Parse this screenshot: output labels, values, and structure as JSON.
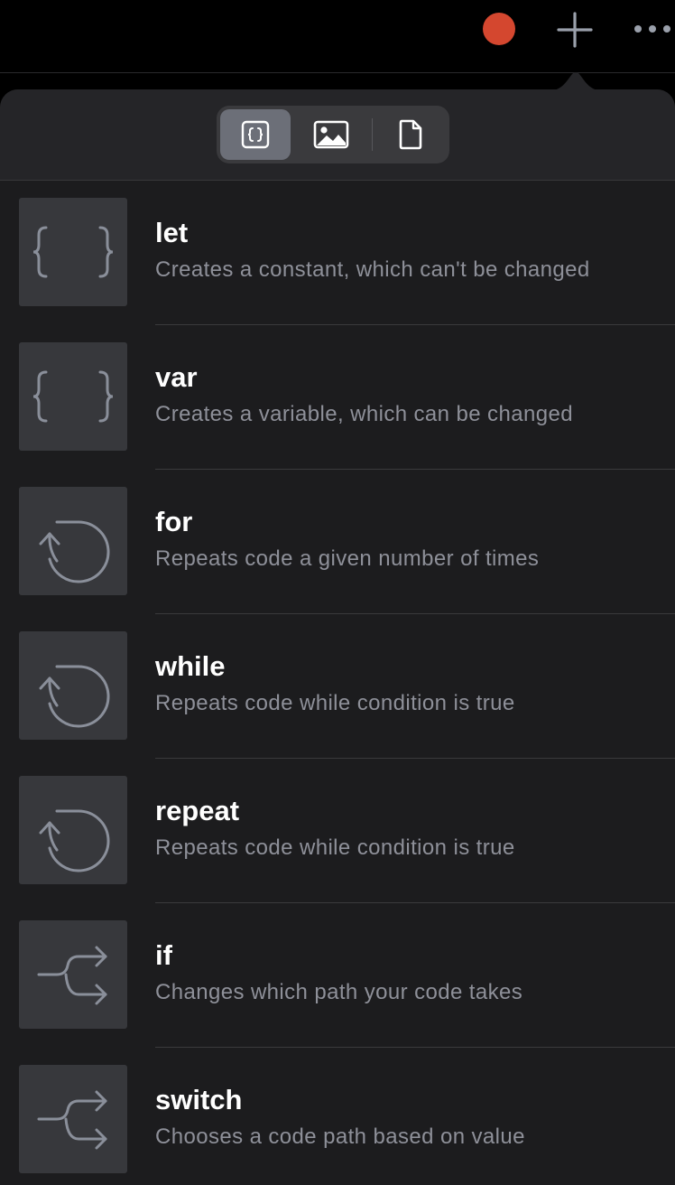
{
  "colors": {
    "record": "#d4472f",
    "accent": "#8e9099",
    "icon_stroke": "#8a8f9a"
  },
  "toolbar": {
    "record_icon": "record-dot-icon",
    "add_icon": "plus-icon",
    "more_icon": "ellipsis-icon"
  },
  "tabs": [
    {
      "icon": "code-braces-icon",
      "selected": true
    },
    {
      "icon": "image-icon",
      "selected": false
    },
    {
      "icon": "file-icon",
      "selected": false
    }
  ],
  "items": [
    {
      "name": "let",
      "description": "Creates a constant, which can't be changed",
      "icon": "braces-icon"
    },
    {
      "name": "var",
      "description": "Creates a variable, which can be changed",
      "icon": "braces-icon"
    },
    {
      "name": "for",
      "description": "Repeats code a given number of times",
      "icon": "loop-icon"
    },
    {
      "name": "while",
      "description": "Repeats code while condition is true",
      "icon": "loop-icon"
    },
    {
      "name": "repeat",
      "description": "Repeats code while condition is true",
      "icon": "loop-icon"
    },
    {
      "name": "if",
      "description": "Changes which path your code takes",
      "icon": "branch-icon"
    },
    {
      "name": "switch",
      "description": "Chooses a code path based on value",
      "icon": "branch-icon"
    }
  ]
}
